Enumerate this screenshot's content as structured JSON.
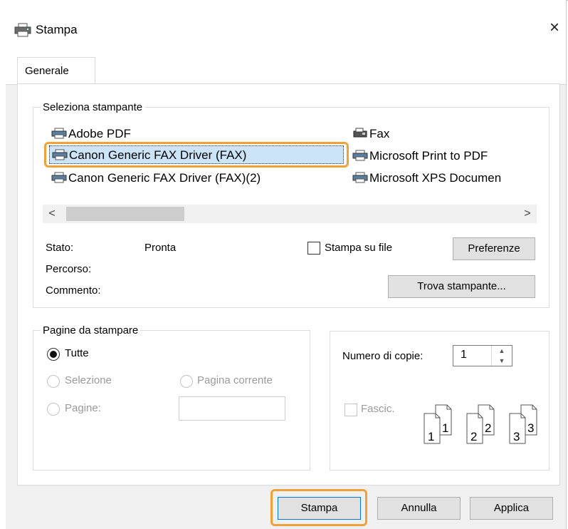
{
  "window": {
    "title": "Stampa",
    "close_symbol": "×"
  },
  "tabs": [
    {
      "label": "Generale",
      "active": true
    }
  ],
  "printer_group": {
    "legend": "Seleziona stampante",
    "printers": [
      {
        "name": "Adobe PDF",
        "icon": "printer-icon",
        "selected": false
      },
      {
        "name": "Canon Generic FAX Driver (FAX)",
        "icon": "printer-icon",
        "selected": true
      },
      {
        "name": "Canon Generic FAX Driver (FAX)(2)",
        "icon": "printer-icon",
        "selected": false
      },
      {
        "name": "Fax",
        "icon": "fax-icon",
        "selected": false
      },
      {
        "name": "Microsoft Print to PDF",
        "icon": "printer-icon",
        "selected": false
      },
      {
        "name": "Microsoft XPS Documen",
        "icon": "printer-icon",
        "selected": false
      }
    ],
    "scroll_left": "<",
    "scroll_right": ">",
    "status_label": "Stato:",
    "status_value": "Pronta",
    "location_label": "Percorso:",
    "comment_label": "Commento:",
    "print_to_file_label": "Stampa su file",
    "print_to_file_checked": false,
    "preferences_button": "Preferenze",
    "find_printer_button": "Trova stampante..."
  },
  "page_range": {
    "legend": "Pagine da stampare",
    "all_label": "Tutte",
    "selection_label": "Selezione",
    "current_page_label": "Pagina corrente",
    "pages_label": "Pagine:",
    "selected_option": "Tutte"
  },
  "copies": {
    "label": "Numero di copie:",
    "value": "1",
    "collate_label": "Fascic.",
    "collate_checked": false,
    "collate_icon_numbers": [
      "1",
      "1",
      "2",
      "2",
      "3",
      "3"
    ]
  },
  "buttons": {
    "print": "Stampa",
    "cancel": "Annulla",
    "apply": "Applica"
  },
  "colors": {
    "highlight": "#f0a23a",
    "selection": "#cce4f7",
    "dialog_bg": "#f0f0f0"
  }
}
